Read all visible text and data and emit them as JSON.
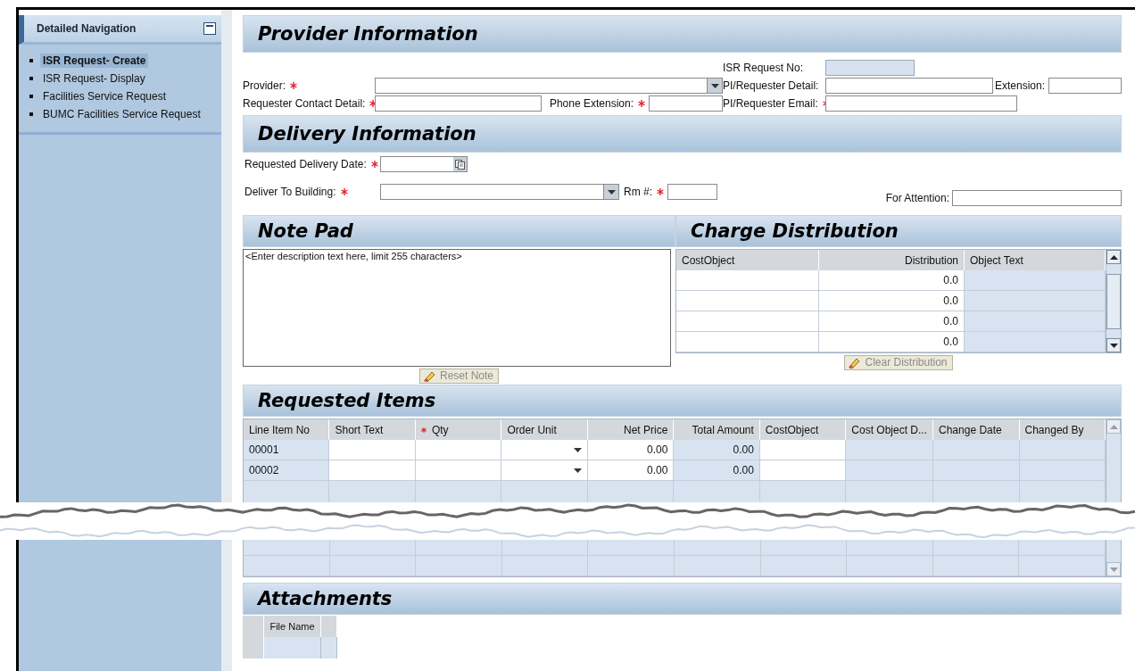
{
  "sidebar": {
    "title": "Detailed Navigation",
    "items": [
      {
        "label": "ISR Request- Create",
        "selected": true
      },
      {
        "label": "ISR Request- Display",
        "selected": false
      },
      {
        "label": "Facilities Service Request",
        "selected": false
      },
      {
        "label": "BUMC Facilities Service Request",
        "selected": false
      }
    ]
  },
  "provider_information": {
    "title": "Provider Information",
    "fields": [
      {
        "label": "ISR Request No:",
        "kind": "text",
        "required": false,
        "disabled": true
      },
      {
        "label": "Provider:",
        "kind": "dropdown",
        "required": true,
        "disabled": false
      },
      {
        "label": "PI/Requester Detail:",
        "kind": "text",
        "required": false,
        "disabled": false
      },
      {
        "label": "Extension:",
        "kind": "text",
        "required": false,
        "disabled": false
      },
      {
        "label": "Requester Contact Detail:",
        "kind": "text",
        "required": true,
        "disabled": false
      },
      {
        "label": "Phone Extension:",
        "kind": "text",
        "required": true,
        "disabled": false
      },
      {
        "label": "PI/Requester Email:",
        "kind": "text",
        "required": true,
        "disabled": false
      }
    ]
  },
  "delivery_information": {
    "title": "Delivery Information",
    "fields": [
      {
        "label": "Requested Delivery Date:",
        "kind": "date",
        "required": true,
        "disabled": false
      },
      {
        "label": "Deliver To Building:",
        "kind": "dropdown",
        "required": true,
        "disabled": false
      },
      {
        "label": "Rm #:",
        "kind": "text",
        "required": true,
        "disabled": false
      },
      {
        "label": "For Attention:",
        "kind": "text",
        "required": false,
        "disabled": false
      }
    ]
  },
  "note_pad": {
    "title": "Note Pad",
    "value": "<Enter description text here, limit 255 characters>",
    "button": {
      "label": "Reset Note",
      "disabled": true
    }
  },
  "charge_distribution": {
    "title": "Charge Distribution",
    "columns": [
      "CostObject",
      "Distribution",
      "Object Text"
    ],
    "rows": [
      {
        "distribution": "0.0"
      },
      {
        "distribution": "0.0"
      },
      {
        "distribution": "0.0"
      },
      {
        "distribution": "0.0"
      }
    ],
    "button": {
      "label": "Clear Distribution",
      "disabled": true
    }
  },
  "requested_items": {
    "title": "Requested Items",
    "columns": [
      {
        "label": "Line Item No",
        "required": false,
        "kind": "readonly"
      },
      {
        "label": "Short Text",
        "required": false,
        "kind": "input"
      },
      {
        "label": "Qty",
        "required": true,
        "kind": "input"
      },
      {
        "label": "Order Unit",
        "required": false,
        "kind": "dropdown"
      },
      {
        "label": "Net Price",
        "required": false,
        "kind": "input",
        "numeric": true
      },
      {
        "label": "Total Amount",
        "required": false,
        "kind": "readonly",
        "numeric": true
      },
      {
        "label": "CostObject",
        "required": false,
        "kind": "input"
      },
      {
        "label": "Cost Object D...",
        "required": false,
        "kind": "readonly"
      },
      {
        "label": "Change Date",
        "required": false,
        "kind": "readonly"
      },
      {
        "label": "Changed By",
        "required": false,
        "kind": "readonly"
      }
    ],
    "rows": [
      {
        "cells": [
          "00001",
          "",
          "",
          "",
          "0.00",
          "0.00",
          "",
          "",
          "",
          ""
        ]
      },
      {
        "cells": [
          "00002",
          "",
          "",
          "",
          "0.00",
          "0.00",
          "",
          "",
          "",
          ""
        ]
      }
    ]
  },
  "attachments": {
    "title": "Attachments",
    "columns": [
      "File Name"
    ]
  }
}
